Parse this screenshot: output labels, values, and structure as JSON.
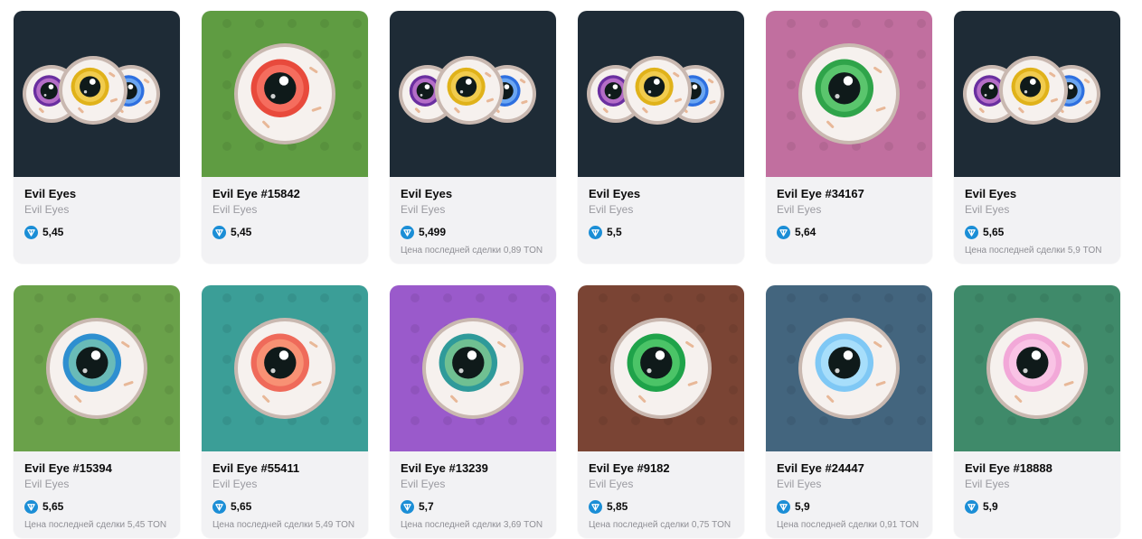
{
  "currency_icon": "ton-diamond-icon",
  "colors": {
    "accent": "#1b8ed6"
  },
  "items": [
    {
      "title": "Evil Eyes",
      "collection": "Evil Eyes",
      "price": "5,45",
      "last_sale": "",
      "bg": "#1e2b36",
      "type": "multi"
    },
    {
      "title": "Evil Eye #15842",
      "collection": "Evil Eyes",
      "price": "5,45",
      "last_sale": "",
      "bg": "#5f9c42",
      "type": "single",
      "iris": "#e84a3c",
      "iris2": "#ff8a7a"
    },
    {
      "title": "Evil Eyes",
      "collection": "Evil Eyes",
      "price": "5,499",
      "last_sale": "Цена последней сделки 0,89 TON",
      "bg": "#1e2b36",
      "type": "multi"
    },
    {
      "title": "Evil Eyes",
      "collection": "Evil Eyes",
      "price": "5,5",
      "last_sale": "",
      "bg": "#1e2b36",
      "type": "multi"
    },
    {
      "title": "Evil Eye #34167",
      "collection": "Evil Eyes",
      "price": "5,64",
      "last_sale": "",
      "bg": "#c16f9f",
      "type": "single",
      "iris": "#2fa44a",
      "iris2": "#7ee08a"
    },
    {
      "title": "Evil Eyes",
      "collection": "Evil Eyes",
      "price": "5,65",
      "last_sale": "Цена последней сделки 5,9 TON",
      "bg": "#1e2b36",
      "type": "multi"
    },
    {
      "title": "Evil Eye #15394",
      "collection": "Evil Eyes",
      "price": "5,65",
      "last_sale": "Цена последней сделки 5,45 TON",
      "bg": "#6aa14a",
      "type": "single",
      "iris": "#2e8fd0",
      "iris2": "#9be0a4"
    },
    {
      "title": "Evil Eye #55411",
      "collection": "Evil Eyes",
      "price": "5,65",
      "last_sale": "Цена последней сделки 5,49 TON",
      "bg": "#3b9e97",
      "type": "single",
      "iris": "#ef6a5a",
      "iris2": "#ffb08a"
    },
    {
      "title": "Evil Eye #13239",
      "collection": "Evil Eyes",
      "price": "5,7",
      "last_sale": "Цена последней сделки 3,69 TON",
      "bg": "#9a5acb",
      "type": "single",
      "iris": "#2f9a9a",
      "iris2": "#a6e08c"
    },
    {
      "title": "Evil Eye #9182",
      "collection": "Evil Eyes",
      "price": "5,85",
      "last_sale": "Цена последней сделки 0,75 TON",
      "bg": "#7a4434",
      "type": "single",
      "iris": "#1fa34a",
      "iris2": "#6fe07f"
    },
    {
      "title": "Evil Eye #24447",
      "collection": "Evil Eyes",
      "price": "5,9",
      "last_sale": "Цена последней сделки 0,91 TON",
      "bg": "#43657e",
      "type": "single",
      "iris": "#7fc8f5",
      "iris2": "#c9f0ff"
    },
    {
      "title": "Evil Eye #18888",
      "collection": "Evil Eyes",
      "price": "5,9",
      "last_sale": "",
      "bg": "#3f8a6a",
      "type": "single",
      "iris": "#f2a8d8",
      "iris2": "#ffd8f0"
    }
  ]
}
